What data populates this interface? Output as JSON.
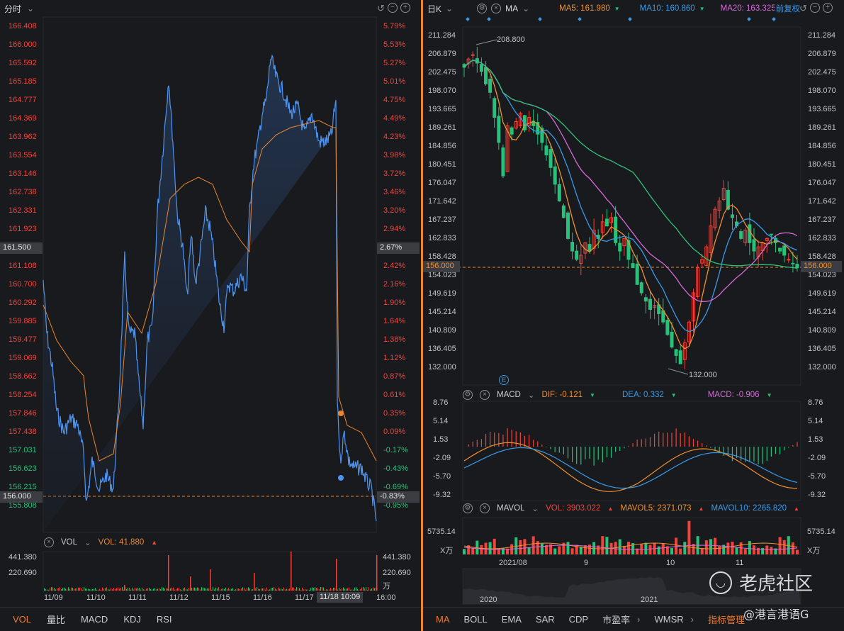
{
  "left": {
    "header": {
      "title": "分时"
    },
    "price_axis": [
      "166.408",
      "166.000",
      "165.592",
      "165.185",
      "164.777",
      "164.369",
      "163.962",
      "163.554",
      "163.146",
      "162.738",
      "162.331",
      "161.923",
      "161.500",
      "161.108",
      "160.700",
      "160.292",
      "159.885",
      "159.477",
      "159.069",
      "158.662",
      "158.254",
      "157.846",
      "157.438",
      "157.031",
      "156.623",
      "156.215",
      "156.000",
      "155.808"
    ],
    "pct_axis": [
      "5.79%",
      "5.53%",
      "5.27%",
      "5.01%",
      "4.75%",
      "4.49%",
      "4.23%",
      "3.98%",
      "3.72%",
      "3.46%",
      "3.20%",
      "2.94%",
      "2.67%",
      "2.42%",
      "2.16%",
      "1.90%",
      "1.64%",
      "1.38%",
      "1.12%",
      "0.87%",
      "0.61%",
      "0.35%",
      "0.09%",
      "-0.17%",
      "-0.43%",
      "-0.69%",
      "-0.83%",
      "-0.95%"
    ],
    "vol": {
      "name": "VOL",
      "value_label": "VOL: 41.880",
      "axis_left": [
        "441.380",
        "220.690"
      ],
      "axis_right": [
        "441.380",
        "220.690",
        "万"
      ]
    },
    "dates": [
      "11/09",
      "11/10",
      "11/11",
      "11/12",
      "11/15",
      "11/16",
      "11/17",
      "11/18 10:09",
      "16:00"
    ],
    "tabs": [
      "VOL",
      "量比",
      "MACD",
      "KDJ",
      "RSI"
    ]
  },
  "right": {
    "header": {
      "period": "日K",
      "indicator": "MA",
      "ma5": "MA5: 161.980",
      "ma10": "MA10: 160.860",
      "ma20": "MA20: 163.325",
      "adjust": "前复权"
    },
    "price_axis_left": [
      "211.284",
      "206.879",
      "202.475",
      "198.070",
      "193.665",
      "189.261",
      "184.856",
      "180.451",
      "176.047",
      "171.642",
      "167.237",
      "162.833",
      "158.428",
      "156.000",
      "154.023",
      "149.619",
      "145.214",
      "140.809",
      "136.405",
      "132.000"
    ],
    "price_axis_right": [
      "211.284",
      "206.879",
      "202.475",
      "198.070",
      "193.665",
      "189.261",
      "184.856",
      "180.451",
      "176.047",
      "171.642",
      "167.237",
      "162.833",
      "158.428",
      "156.000",
      "154.023",
      "149.619",
      "145.214",
      "140.809",
      "136.405",
      "132.000"
    ],
    "annotations": {
      "high": "208.800",
      "low": "132.000",
      "e_marker": "E"
    },
    "macd": {
      "name": "MACD",
      "dif": "DIF: -0.121",
      "dea": "DEA: 0.332",
      "macd": "MACD: -0.906",
      "axis": [
        "8.76",
        "5.14",
        "1.53",
        "-2.09",
        "-5.70",
        "-9.32"
      ]
    },
    "vol": {
      "name": "MAVOL",
      "vol": "VOL: 3903.022",
      "mavol5": "MAVOL5: 2371.073",
      "mavol10": "MAVOL10: 2265.820",
      "axis": [
        "5735.14",
        "X万"
      ]
    },
    "dates": [
      "2021/08",
      "9",
      "10",
      "11"
    ],
    "overview_years": [
      "2020",
      "2021"
    ],
    "tabs": [
      "MA",
      "BOLL",
      "EMA",
      "SAR",
      "CDP",
      "市盈率",
      "WMSR",
      "指标管理"
    ],
    "watermark_brand": "老虎社区",
    "watermark_user": "@港言港语G"
  },
  "colors": {
    "up": "#f0443a",
    "down": "#27c27a",
    "line_blue": "#4f94f0",
    "avg_orange": "#e8862e",
    "ma5": "#f0902e",
    "ma10": "#3a9ae8",
    "ma20": "#d66ad8",
    "ma60": "#2fc27a"
  }
}
